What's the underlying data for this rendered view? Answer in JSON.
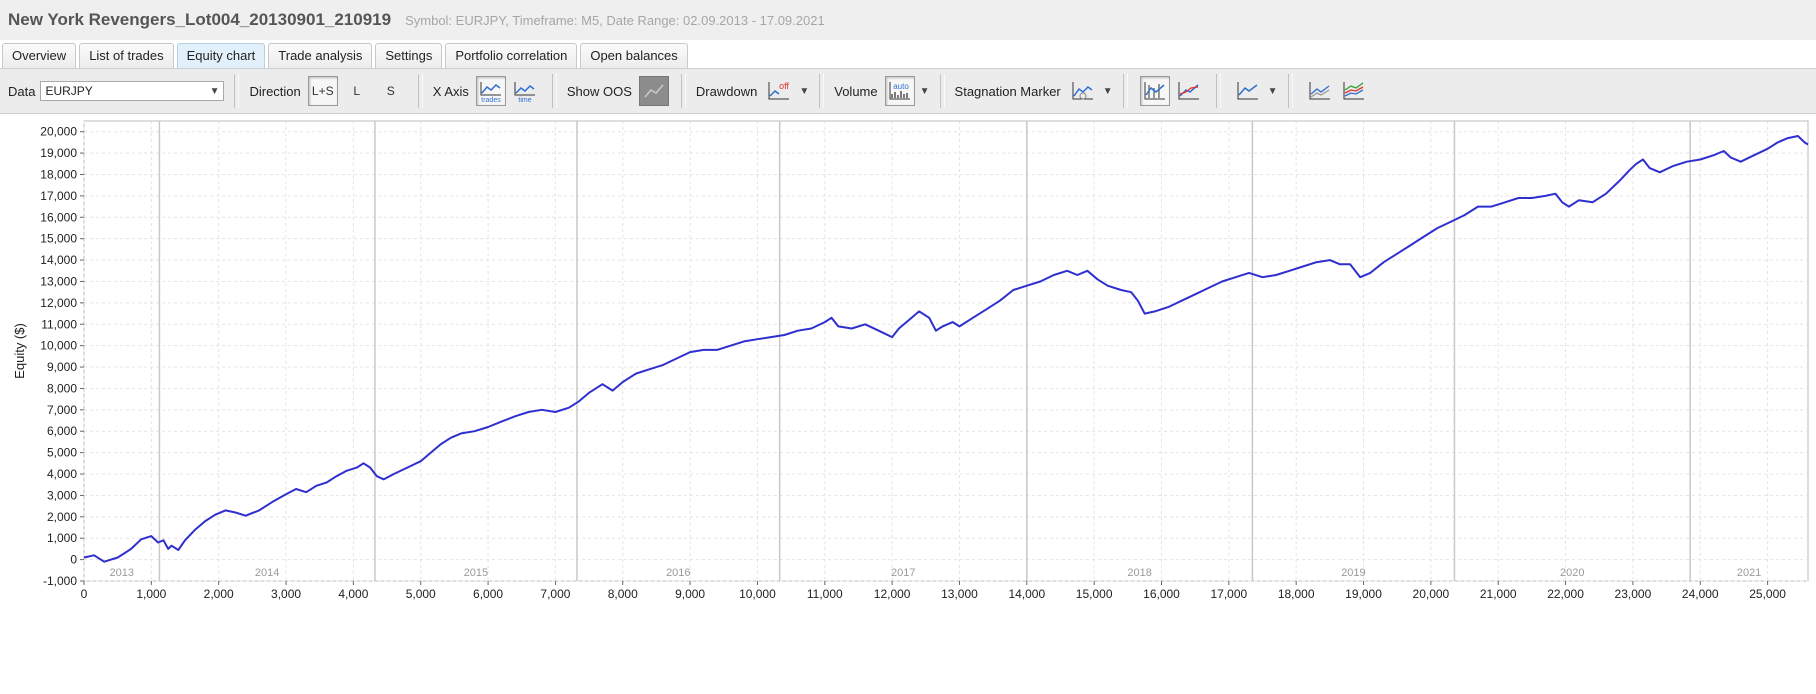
{
  "window": {
    "title": "New York Revengers_Lot004_20130901_210919",
    "subtitle": "Symbol: EURJPY, Timeframe: M5, Date Range: 02.09.2013 - 17.09.2021"
  },
  "tabs": [
    {
      "label": "Overview",
      "active": false
    },
    {
      "label": "List of trades",
      "active": false
    },
    {
      "label": "Equity chart",
      "active": true
    },
    {
      "label": "Trade analysis",
      "active": false
    },
    {
      "label": "Settings",
      "active": false
    },
    {
      "label": "Portfolio correlation",
      "active": false
    },
    {
      "label": "Open balances",
      "active": false
    }
  ],
  "toolbar": {
    "data_label": "Data",
    "data_value": "EURJPY",
    "direction_label": "Direction",
    "direction_options": [
      "L+S",
      "L",
      "S"
    ],
    "direction_selected": "L+S",
    "xaxis_label": "X Axis",
    "xaxis_trades": "trades",
    "xaxis_time": "time",
    "xaxis_selected": "trades",
    "show_oos_label": "Show OOS",
    "drawdown_label": "Drawdown",
    "drawdown_state": "off",
    "volume_label": "Volume",
    "volume_state": "auto",
    "stagnation_label": "Stagnation Marker"
  },
  "colors": {
    "equity_line": "#2f2fd0",
    "grid": "#e4e4e4",
    "year_line": "#c8c8c8",
    "active_tab": "#e2f0fb"
  },
  "chart_data": {
    "type": "line",
    "title": "",
    "xlabel": "",
    "ylabel": "Equity ($)",
    "xlim": [
      0,
      25600
    ],
    "ylim": [
      -1000,
      20500
    ],
    "x_ticks": [
      0,
      1000,
      2000,
      3000,
      4000,
      5000,
      6000,
      7000,
      8000,
      9000,
      10000,
      11000,
      12000,
      13000,
      14000,
      15000,
      16000,
      17000,
      18000,
      19000,
      20000,
      21000,
      22000,
      23000,
      24000,
      25000
    ],
    "x_tick_labels": [
      "0",
      "1,000",
      "2,000",
      "3,000",
      "4,000",
      "5,000",
      "6,000",
      "7,000",
      "8,000",
      "9,000",
      "10,000",
      "11,000",
      "12,000",
      "13,000",
      "14,000",
      "15,000",
      "16,000",
      "17,000",
      "18,000",
      "19,000",
      "20,000",
      "21,000",
      "22,000",
      "23,000",
      "24,000",
      "25,000"
    ],
    "y_ticks": [
      -1000,
      0,
      1000,
      2000,
      3000,
      4000,
      5000,
      6000,
      7000,
      8000,
      9000,
      10000,
      11000,
      12000,
      13000,
      14000,
      15000,
      16000,
      17000,
      18000,
      19000,
      20000
    ],
    "y_tick_labels": [
      "-1,000",
      "0",
      "1,000",
      "2,000",
      "3,000",
      "4,000",
      "5,000",
      "6,000",
      "7,000",
      "8,000",
      "9,000",
      "10,000",
      "11,000",
      "12,000",
      "13,000",
      "14,000",
      "15,000",
      "16,000",
      "17,000",
      "18,000",
      "19,000",
      "20,000"
    ],
    "year_boundaries": [
      1120,
      4320,
      7320,
      10330,
      14000,
      17350,
      20350,
      23850
    ],
    "year_labels": [
      {
        "label": "2013",
        "x": 560
      },
      {
        "label": "2014",
        "x": 2720
      },
      {
        "label": "2015",
        "x": 5820
      },
      {
        "label": "2016",
        "x": 8825
      },
      {
        "label": "2017",
        "x": 12165
      },
      {
        "label": "2018",
        "x": 15675
      },
      {
        "label": "2019",
        "x": 18850
      },
      {
        "label": "2020",
        "x": 22100
      },
      {
        "label": "2021",
        "x": 24725
      }
    ],
    "grid": true,
    "series": [
      {
        "name": "",
        "points": [
          [
            0,
            100
          ],
          [
            150,
            200
          ],
          [
            300,
            -100
          ],
          [
            500,
            100
          ],
          [
            700,
            500
          ],
          [
            850,
            950
          ],
          [
            1000,
            1100
          ],
          [
            1100,
            800
          ],
          [
            1180,
            900
          ],
          [
            1250,
            500
          ],
          [
            1300,
            650
          ],
          [
            1400,
            450
          ],
          [
            1500,
            900
          ],
          [
            1650,
            1400
          ],
          [
            1800,
            1800
          ],
          [
            1950,
            2100
          ],
          [
            2100,
            2300
          ],
          [
            2250,
            2200
          ],
          [
            2400,
            2050
          ],
          [
            2600,
            2300
          ],
          [
            2800,
            2700
          ],
          [
            3000,
            3050
          ],
          [
            3150,
            3300
          ],
          [
            3300,
            3150
          ],
          [
            3450,
            3450
          ],
          [
            3600,
            3600
          ],
          [
            3750,
            3900
          ],
          [
            3900,
            4150
          ],
          [
            4050,
            4300
          ],
          [
            4150,
            4500
          ],
          [
            4250,
            4300
          ],
          [
            4350,
            3900
          ],
          [
            4450,
            3750
          ],
          [
            4600,
            4000
          ],
          [
            4800,
            4300
          ],
          [
            5000,
            4600
          ],
          [
            5150,
            5000
          ],
          [
            5300,
            5400
          ],
          [
            5450,
            5700
          ],
          [
            5600,
            5900
          ],
          [
            5800,
            6000
          ],
          [
            6000,
            6200
          ],
          [
            6200,
            6450
          ],
          [
            6400,
            6700
          ],
          [
            6600,
            6900
          ],
          [
            6800,
            7000
          ],
          [
            7000,
            6900
          ],
          [
            7200,
            7100
          ],
          [
            7350,
            7400
          ],
          [
            7500,
            7800
          ],
          [
            7700,
            8200
          ],
          [
            7850,
            7900
          ],
          [
            8000,
            8300
          ],
          [
            8200,
            8700
          ],
          [
            8400,
            8900
          ],
          [
            8600,
            9100
          ],
          [
            8800,
            9400
          ],
          [
            9000,
            9700
          ],
          [
            9200,
            9800
          ],
          [
            9400,
            9800
          ],
          [
            9600,
            10000
          ],
          [
            9800,
            10200
          ],
          [
            10000,
            10300
          ],
          [
            10200,
            10400
          ],
          [
            10400,
            10500
          ],
          [
            10600,
            10700
          ],
          [
            10800,
            10800
          ],
          [
            11000,
            11100
          ],
          [
            11100,
            11300
          ],
          [
            11200,
            10900
          ],
          [
            11400,
            10800
          ],
          [
            11600,
            11000
          ],
          [
            11800,
            10700
          ],
          [
            12000,
            10400
          ],
          [
            12100,
            10800
          ],
          [
            12250,
            11200
          ],
          [
            12400,
            11600
          ],
          [
            12550,
            11300
          ],
          [
            12650,
            10700
          ],
          [
            12750,
            10900
          ],
          [
            12900,
            11100
          ],
          [
            13000,
            10900
          ],
          [
            13200,
            11300
          ],
          [
            13400,
            11700
          ],
          [
            13600,
            12100
          ],
          [
            13800,
            12600
          ],
          [
            14000,
            12800
          ],
          [
            14200,
            13000
          ],
          [
            14400,
            13300
          ],
          [
            14600,
            13500
          ],
          [
            14750,
            13300
          ],
          [
            14900,
            13500
          ],
          [
            15050,
            13100
          ],
          [
            15200,
            12800
          ],
          [
            15400,
            12600
          ],
          [
            15550,
            12500
          ],
          [
            15650,
            12100
          ],
          [
            15750,
            11500
          ],
          [
            15900,
            11600
          ],
          [
            16100,
            11800
          ],
          [
            16300,
            12100
          ],
          [
            16500,
            12400
          ],
          [
            16700,
            12700
          ],
          [
            16900,
            13000
          ],
          [
            17100,
            13200
          ],
          [
            17300,
            13400
          ],
          [
            17500,
            13200
          ],
          [
            17700,
            13300
          ],
          [
            17900,
            13500
          ],
          [
            18100,
            13700
          ],
          [
            18300,
            13900
          ],
          [
            18500,
            14000
          ],
          [
            18650,
            13800
          ],
          [
            18800,
            13800
          ],
          [
            18950,
            13200
          ],
          [
            19100,
            13400
          ],
          [
            19300,
            13900
          ],
          [
            19500,
            14300
          ],
          [
            19700,
            14700
          ],
          [
            19900,
            15100
          ],
          [
            20100,
            15500
          ],
          [
            20300,
            15800
          ],
          [
            20500,
            16100
          ],
          [
            20700,
            16500
          ],
          [
            20900,
            16500
          ],
          [
            21100,
            16700
          ],
          [
            21300,
            16900
          ],
          [
            21500,
            16900
          ],
          [
            21700,
            17000
          ],
          [
            21850,
            17100
          ],
          [
            21950,
            16700
          ],
          [
            22050,
            16500
          ],
          [
            22200,
            16800
          ],
          [
            22400,
            16700
          ],
          [
            22600,
            17100
          ],
          [
            22800,
            17700
          ],
          [
            22950,
            18200
          ],
          [
            23050,
            18500
          ],
          [
            23150,
            18700
          ],
          [
            23250,
            18300
          ],
          [
            23400,
            18100
          ],
          [
            23600,
            18400
          ],
          [
            23800,
            18600
          ],
          [
            24000,
            18700
          ],
          [
            24200,
            18900
          ],
          [
            24350,
            19100
          ],
          [
            24450,
            18800
          ],
          [
            24600,
            18600
          ],
          [
            24800,
            18900
          ],
          [
            25000,
            19200
          ],
          [
            25150,
            19500
          ],
          [
            25300,
            19700
          ],
          [
            25450,
            19800
          ],
          [
            25550,
            19500
          ],
          [
            25600,
            19400
          ]
        ]
      }
    ]
  }
}
